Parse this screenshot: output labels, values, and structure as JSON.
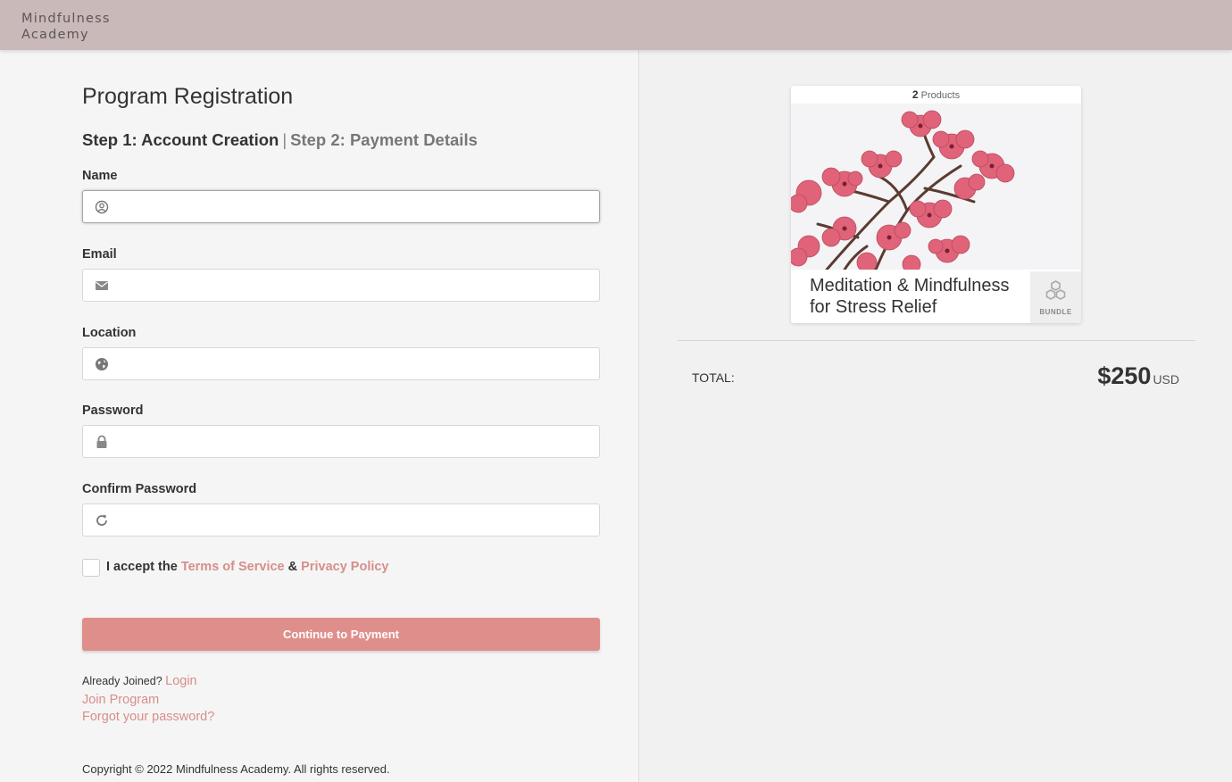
{
  "header": {
    "brand": "Mindfulness\nAcademy"
  },
  "form": {
    "title": "Program Registration",
    "step1": "Step 1: Account Creation",
    "separator": "|",
    "step2": "Step 2: Payment Details",
    "fields": [
      {
        "label": "Name",
        "icon": "user-circle-icon",
        "value": "",
        "placeholder": ""
      },
      {
        "label": "Email",
        "icon": "envelope-icon",
        "value": "",
        "placeholder": ""
      },
      {
        "label": "Location",
        "icon": "globe-icon",
        "value": "",
        "placeholder": ""
      },
      {
        "label": "Password",
        "icon": "lock-icon",
        "value": "",
        "placeholder": ""
      },
      {
        "label": "Confirm Password",
        "icon": "refresh-icon",
        "value": "",
        "placeholder": ""
      }
    ],
    "terms": {
      "prefix": "I accept the",
      "tos": "Terms of Service",
      "amp": "&",
      "privacy": "Privacy Policy",
      "checked": false
    },
    "submit": "Continue to Payment",
    "already_joined": "Already Joined?",
    "login": "Login",
    "join": "Join Program",
    "forgot": "Forgot your password?",
    "copyright": "Copyright © 2022 Mindfulness Academy. All rights reserved."
  },
  "summary": {
    "count": "2",
    "count_label": "Products",
    "product_title": "Meditation & Mindfulness for Stress Relief",
    "bundle_label": "BUNDLE",
    "total_label": "TOTAL:",
    "total_amount": "$250",
    "currency": "USD"
  },
  "colors": {
    "header": "#c9b9b9",
    "accent": "#df8f8b",
    "link": "#d58f8a",
    "blossom": "#e0637a"
  }
}
